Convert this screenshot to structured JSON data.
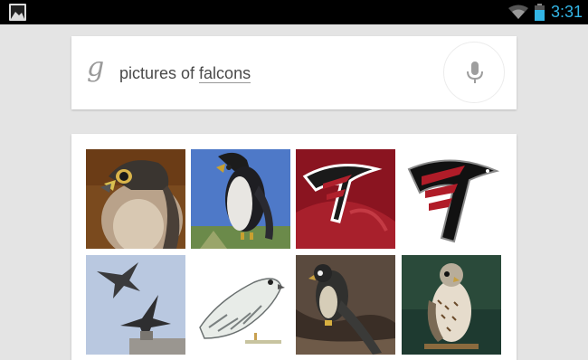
{
  "status_bar": {
    "time": "3:31",
    "notification_icon": "gallery-icon",
    "wifi_icon": "wifi-icon",
    "battery_icon": "battery-icon",
    "time_color": "#33b5e5"
  },
  "search": {
    "logo": "g",
    "query_prefix": "pictures of ",
    "query_keyword": "falcons",
    "mic_icon": "microphone-icon"
  },
  "results": {
    "images": [
      {
        "label": "peregrine-falcon-portrait"
      },
      {
        "label": "falcon-on-branch-blue-sky"
      },
      {
        "label": "atlanta-falcons-logo-red"
      },
      {
        "label": "atlanta-falcons-logo"
      },
      {
        "label": "falcons-in-flight"
      },
      {
        "label": "white-gyrfalcon-drawing"
      },
      {
        "label": "falcon-on-rock"
      },
      {
        "label": "kestrel-on-perch"
      }
    ]
  }
}
